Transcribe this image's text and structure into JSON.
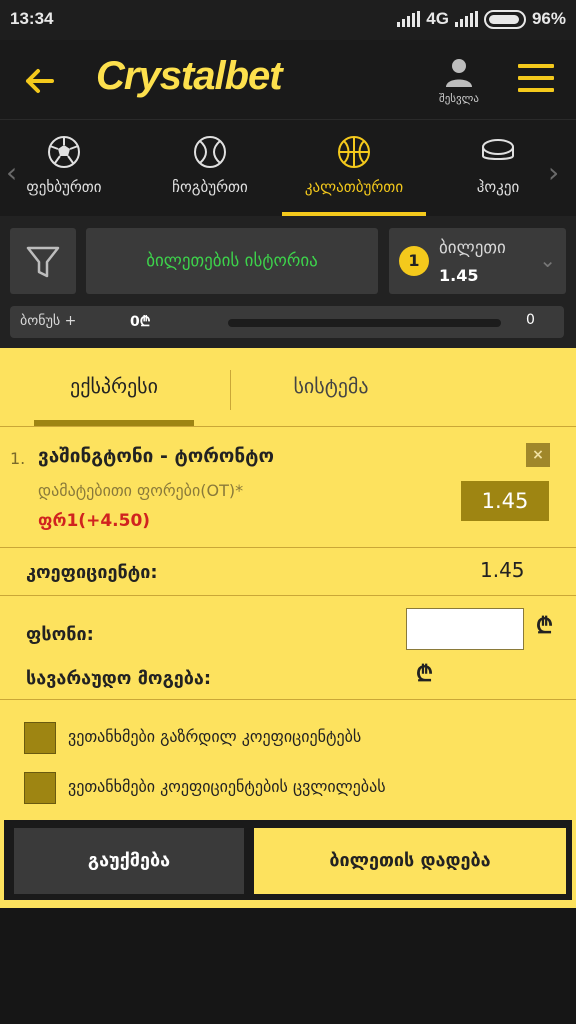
{
  "status_bar": {
    "time": "13:34",
    "network": "4G",
    "battery": "96%"
  },
  "header": {
    "brand_left": "Crystal",
    "brand_right": "bet",
    "user_label": "შესვლა"
  },
  "sports": [
    {
      "label": "ფეხბურთი",
      "icon": "football-icon"
    },
    {
      "label": "ჩოგბურთი",
      "icon": "tennis-icon"
    },
    {
      "label": "კალათბურთი",
      "icon": "basketball-icon",
      "active": true
    },
    {
      "label": "ჰოკეი",
      "icon": "hockey-puck-icon"
    }
  ],
  "controls": {
    "history_label": "ბილეთების ისტორია",
    "ticket_count": "1",
    "ticket_label": "ბილეთი",
    "ticket_odds": "1.45",
    "bonus_label": "ბონუს +",
    "bonus_value": "0₾",
    "bonus_right": "0"
  },
  "betslip": {
    "tabs": [
      {
        "label": "ექსპრესი",
        "active": true
      },
      {
        "label": "სისტემა"
      }
    ],
    "bet": {
      "index": "1.",
      "match": "ვაშინგტონი - ტორონტო",
      "market": "დამატებითი ფორები(OT)*",
      "selection": "ფრ1(+4.50)",
      "odds": "1.45",
      "close_symbol": "×"
    },
    "coefficient_label": "კოეფიციენტი:",
    "coefficient_value": "1.45",
    "stake_label": "ფსონი:",
    "stake_value": "",
    "currency": "₾",
    "expected_win_label": "სავარაუდო მოგება:",
    "agree_increased": "ვეთანხმები გაზრდილ კოეფიციენტებს",
    "agree_changes": "ვეთანხმები კოეფიციენტების ცვლილებას",
    "cancel_label": "გაუქმება",
    "place_label": "ბილეთის დადება"
  },
  "colors": {
    "accent": "#fde25e",
    "accent_dark": "#9e8512",
    "history_green": "#3dd34b",
    "selection_red": "#d0231f"
  }
}
